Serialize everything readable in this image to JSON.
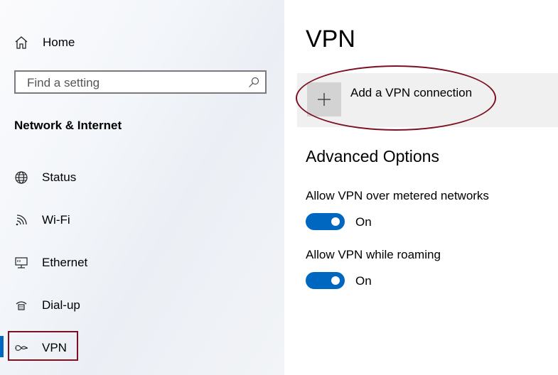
{
  "sidebar": {
    "home_label": "Home",
    "search": {
      "placeholder": "Find a setting"
    },
    "section_title": "Network & Internet",
    "items": [
      {
        "label": "Status",
        "icon": "globe-icon"
      },
      {
        "label": "Wi-Fi",
        "icon": "wifi-icon"
      },
      {
        "label": "Ethernet",
        "icon": "ethernet-icon"
      },
      {
        "label": "Dial-up",
        "icon": "dialup-icon"
      },
      {
        "label": "VPN",
        "icon": "vpn-icon",
        "selected": true
      }
    ]
  },
  "main": {
    "title": "VPN",
    "add_vpn_label": "Add a VPN connection",
    "advanced_heading": "Advanced Options",
    "options": [
      {
        "label": "Allow VPN over metered networks",
        "state": "On",
        "on": true
      },
      {
        "label": "Allow VPN while roaming",
        "state": "On",
        "on": true
      }
    ]
  },
  "colors": {
    "accent": "#0067c0",
    "annotation": "#7b1020"
  }
}
